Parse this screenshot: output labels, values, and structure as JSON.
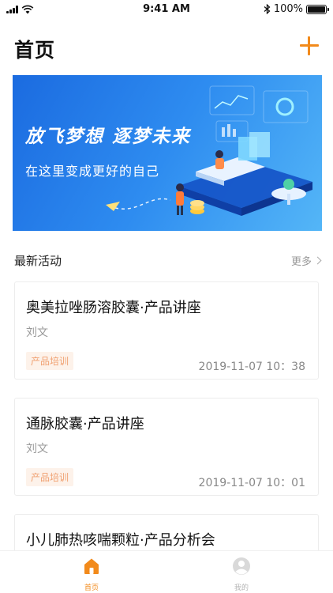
{
  "status_bar": {
    "time": "9:41 AM",
    "battery_text": "100%",
    "battery_level": 1.0
  },
  "header": {
    "title": "首页",
    "add_icon": "plus-icon",
    "accent_color": "#f28a1b"
  },
  "banner": {
    "title": "放飞梦想  逐梦未来",
    "subtitle": "在这里变成更好的自己"
  },
  "section": {
    "title": "最新活动",
    "more_label": "更多"
  },
  "activities": [
    {
      "title": "奥美拉唑肠溶胶囊·产品讲座",
      "author": "刘文",
      "tag": "产品培训",
      "time": "2019-11-07 10：38"
    },
    {
      "title": "通脉胶囊·产品讲座",
      "author": "刘文",
      "tag": "产品培训",
      "time": "2019-11-07 10：01"
    },
    {
      "title": "小儿肺热咳喘颗粒·产品分析会",
      "author": "",
      "tag": "",
      "time": ""
    }
  ],
  "tab_bar": {
    "home_label": "首页",
    "mine_label": "我的",
    "home_icon": "home-icon",
    "mine_icon": "user-icon"
  }
}
